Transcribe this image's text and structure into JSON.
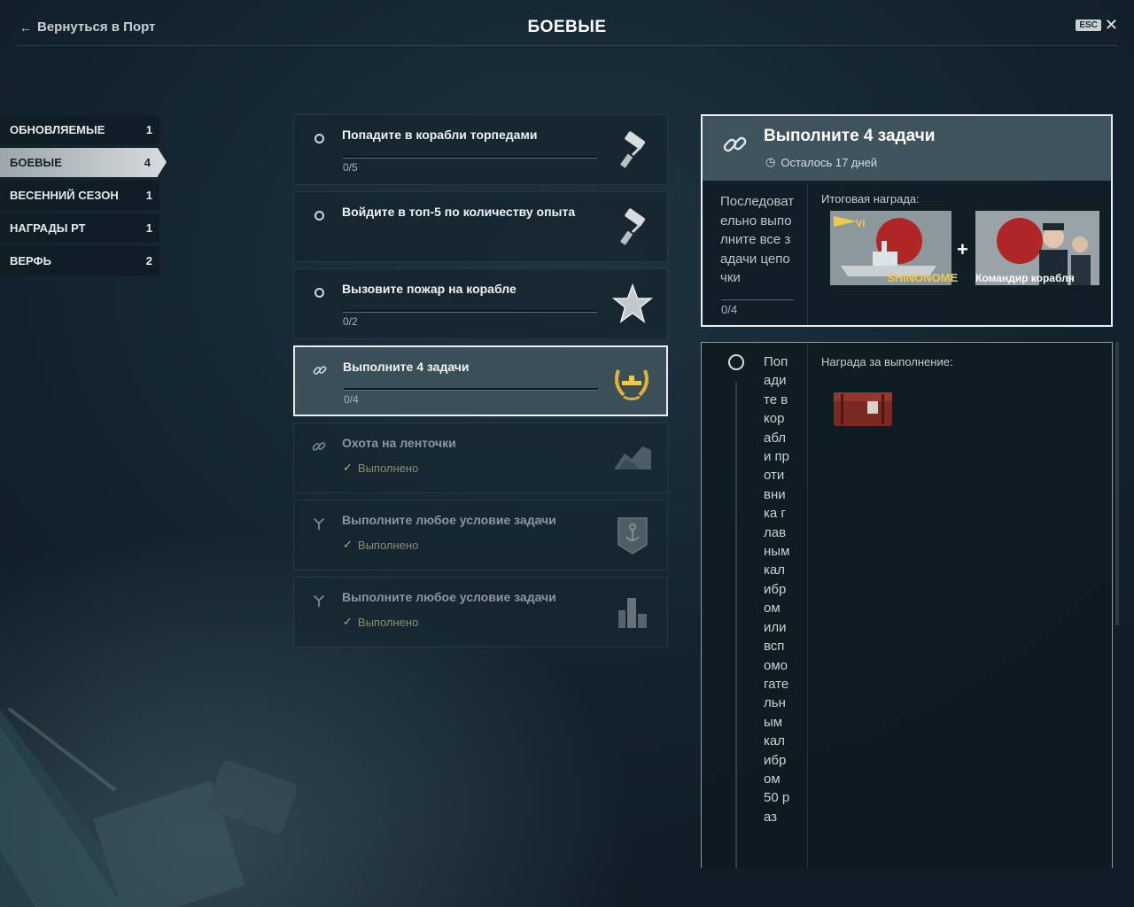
{
  "header": {
    "back_label": "Вернуться в Порт",
    "title": "БОЕВЫЕ",
    "esc_label": "ESC",
    "close_glyph": "✕"
  },
  "sidebar": {
    "items": [
      {
        "label": "ОБНОВЛЯЕМЫЕ",
        "count": "1"
      },
      {
        "label": "БОЕВЫЕ",
        "count": "4",
        "active": true
      },
      {
        "label": "ВЕСЕННИЙ СЕЗОН",
        "count": "1"
      },
      {
        "label": "НАГРАДЫ РТ",
        "count": "1"
      },
      {
        "label": "ВЕРФЬ",
        "count": "2"
      }
    ]
  },
  "tasks": [
    {
      "title": "Попадите в корабли торпедами",
      "progress": "0/5",
      "progress_fraction": 0,
      "status_icon": "circle-icon",
      "reward_icon": "paint-roller-icon"
    },
    {
      "title": "Войдите в топ-5 по количеству опыта",
      "status_icon": "circle-icon",
      "reward_icon": "paint-roller-icon"
    },
    {
      "title": "Вызовите пожар на корабле",
      "progress": "0/2",
      "progress_fraction": 0,
      "status_icon": "circle-icon",
      "reward_icon": "star-icon"
    },
    {
      "title": "Выполните 4 задачи",
      "progress": "0/4",
      "progress_fraction": 0,
      "status_icon": "chain-link-icon",
      "reward_icon": "laurel-ship-icon",
      "selected": true
    },
    {
      "title": "Охота на ленточки",
      "status": "Выполнено",
      "status_icon": "chain-link-icon",
      "reward_icon": "camouflage-icon",
      "done": true
    },
    {
      "title": "Выполните любое условие задачи",
      "status": "Выполнено",
      "status_icon": "branch-icon",
      "reward_icon": "anchor-badge-icon",
      "done": true
    },
    {
      "title": "Выполните любое условие задачи",
      "status": "Выполнено",
      "status_icon": "branch-icon",
      "reward_icon": "port-slot-icon",
      "done": true
    }
  ],
  "chain": {
    "title": "Выполните 4 задачи",
    "time_left": "Осталось 17 дней",
    "description": "Последовательно выполните все задачи цепочки",
    "progress": "0/4",
    "progress_fraction": 0,
    "reward_label": "Итоговая награда:",
    "ship_tier": "VI",
    "ship_name": "SHINONOME",
    "plus": "+",
    "commander_label": "Командир корабля"
  },
  "detail": {
    "text": "Попадите в корабли противника главным калибром или вспомогательным калибром 50 раз",
    "reward_label": "Награда за выполнение:",
    "reward_icon": "supply-crate-icon"
  },
  "colors": {
    "accent_gold": "#f0c84a",
    "done_check": "#b4b078",
    "selected_border": "#e9eef0",
    "background": "#142530"
  }
}
